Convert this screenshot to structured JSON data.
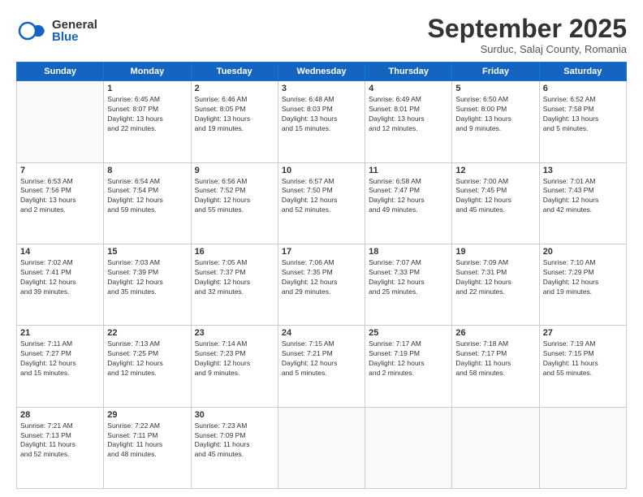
{
  "header": {
    "logo_general": "General",
    "logo_blue": "Blue",
    "month": "September 2025",
    "location": "Surduc, Salaj County, Romania"
  },
  "days_of_week": [
    "Sunday",
    "Monday",
    "Tuesday",
    "Wednesday",
    "Thursday",
    "Friday",
    "Saturday"
  ],
  "weeks": [
    [
      {
        "day": "",
        "info": ""
      },
      {
        "day": "1",
        "info": "Sunrise: 6:45 AM\nSunset: 8:07 PM\nDaylight: 13 hours\nand 22 minutes."
      },
      {
        "day": "2",
        "info": "Sunrise: 6:46 AM\nSunset: 8:05 PM\nDaylight: 13 hours\nand 19 minutes."
      },
      {
        "day": "3",
        "info": "Sunrise: 6:48 AM\nSunset: 8:03 PM\nDaylight: 13 hours\nand 15 minutes."
      },
      {
        "day": "4",
        "info": "Sunrise: 6:49 AM\nSunset: 8:01 PM\nDaylight: 13 hours\nand 12 minutes."
      },
      {
        "day": "5",
        "info": "Sunrise: 6:50 AM\nSunset: 8:00 PM\nDaylight: 13 hours\nand 9 minutes."
      },
      {
        "day": "6",
        "info": "Sunrise: 6:52 AM\nSunset: 7:58 PM\nDaylight: 13 hours\nand 5 minutes."
      }
    ],
    [
      {
        "day": "7",
        "info": "Sunrise: 6:53 AM\nSunset: 7:56 PM\nDaylight: 13 hours\nand 2 minutes."
      },
      {
        "day": "8",
        "info": "Sunrise: 6:54 AM\nSunset: 7:54 PM\nDaylight: 12 hours\nand 59 minutes."
      },
      {
        "day": "9",
        "info": "Sunrise: 6:56 AM\nSunset: 7:52 PM\nDaylight: 12 hours\nand 55 minutes."
      },
      {
        "day": "10",
        "info": "Sunrise: 6:57 AM\nSunset: 7:50 PM\nDaylight: 12 hours\nand 52 minutes."
      },
      {
        "day": "11",
        "info": "Sunrise: 6:58 AM\nSunset: 7:47 PM\nDaylight: 12 hours\nand 49 minutes."
      },
      {
        "day": "12",
        "info": "Sunrise: 7:00 AM\nSunset: 7:45 PM\nDaylight: 12 hours\nand 45 minutes."
      },
      {
        "day": "13",
        "info": "Sunrise: 7:01 AM\nSunset: 7:43 PM\nDaylight: 12 hours\nand 42 minutes."
      }
    ],
    [
      {
        "day": "14",
        "info": "Sunrise: 7:02 AM\nSunset: 7:41 PM\nDaylight: 12 hours\nand 39 minutes."
      },
      {
        "day": "15",
        "info": "Sunrise: 7:03 AM\nSunset: 7:39 PM\nDaylight: 12 hours\nand 35 minutes."
      },
      {
        "day": "16",
        "info": "Sunrise: 7:05 AM\nSunset: 7:37 PM\nDaylight: 12 hours\nand 32 minutes."
      },
      {
        "day": "17",
        "info": "Sunrise: 7:06 AM\nSunset: 7:35 PM\nDaylight: 12 hours\nand 29 minutes."
      },
      {
        "day": "18",
        "info": "Sunrise: 7:07 AM\nSunset: 7:33 PM\nDaylight: 12 hours\nand 25 minutes."
      },
      {
        "day": "19",
        "info": "Sunrise: 7:09 AM\nSunset: 7:31 PM\nDaylight: 12 hours\nand 22 minutes."
      },
      {
        "day": "20",
        "info": "Sunrise: 7:10 AM\nSunset: 7:29 PM\nDaylight: 12 hours\nand 19 minutes."
      }
    ],
    [
      {
        "day": "21",
        "info": "Sunrise: 7:11 AM\nSunset: 7:27 PM\nDaylight: 12 hours\nand 15 minutes."
      },
      {
        "day": "22",
        "info": "Sunrise: 7:13 AM\nSunset: 7:25 PM\nDaylight: 12 hours\nand 12 minutes."
      },
      {
        "day": "23",
        "info": "Sunrise: 7:14 AM\nSunset: 7:23 PM\nDaylight: 12 hours\nand 9 minutes."
      },
      {
        "day": "24",
        "info": "Sunrise: 7:15 AM\nSunset: 7:21 PM\nDaylight: 12 hours\nand 5 minutes."
      },
      {
        "day": "25",
        "info": "Sunrise: 7:17 AM\nSunset: 7:19 PM\nDaylight: 12 hours\nand 2 minutes."
      },
      {
        "day": "26",
        "info": "Sunrise: 7:18 AM\nSunset: 7:17 PM\nDaylight: 11 hours\nand 58 minutes."
      },
      {
        "day": "27",
        "info": "Sunrise: 7:19 AM\nSunset: 7:15 PM\nDaylight: 11 hours\nand 55 minutes."
      }
    ],
    [
      {
        "day": "28",
        "info": "Sunrise: 7:21 AM\nSunset: 7:13 PM\nDaylight: 11 hours\nand 52 minutes."
      },
      {
        "day": "29",
        "info": "Sunrise: 7:22 AM\nSunset: 7:11 PM\nDaylight: 11 hours\nand 48 minutes."
      },
      {
        "day": "30",
        "info": "Sunrise: 7:23 AM\nSunset: 7:09 PM\nDaylight: 11 hours\nand 45 minutes."
      },
      {
        "day": "",
        "info": ""
      },
      {
        "day": "",
        "info": ""
      },
      {
        "day": "",
        "info": ""
      },
      {
        "day": "",
        "info": ""
      }
    ]
  ]
}
